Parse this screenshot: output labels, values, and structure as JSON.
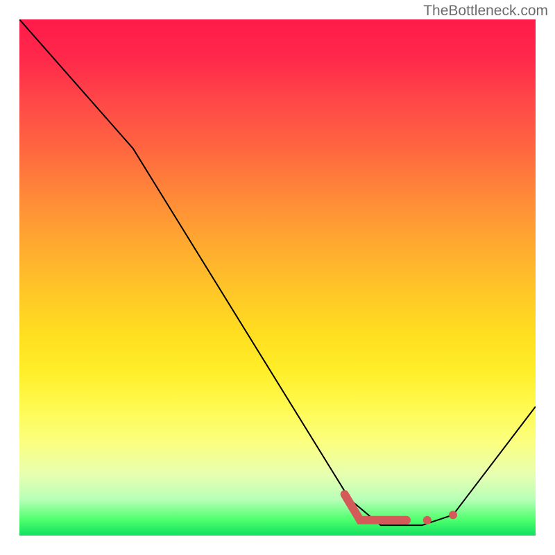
{
  "watermark": "TheBottleneck.com",
  "chart_data": {
    "type": "line",
    "title": "",
    "xlabel": "",
    "ylabel": "",
    "xlim": [
      0,
      100
    ],
    "ylim": [
      0,
      100
    ],
    "grid": false,
    "legend": false,
    "series": [
      {
        "name": "bottleneck-curve",
        "x": [
          0,
          22,
          64,
          70,
          78,
          84,
          100
        ],
        "y": [
          100,
          75,
          7,
          2,
          2,
          4,
          25
        ],
        "color": "#000000"
      }
    ],
    "highlight": {
      "name": "optimal-range",
      "type": "segment",
      "points": [
        {
          "x": 63,
          "y": 8
        },
        {
          "x": 66,
          "y": 3
        },
        {
          "x": 75,
          "y": 3
        }
      ],
      "dots": [
        {
          "x": 79,
          "y": 3
        },
        {
          "x": 84,
          "y": 4
        }
      ],
      "color": "#d45a5a"
    },
    "background": {
      "type": "vertical-gradient",
      "stops": [
        {
          "pos": 0.0,
          "color": "#ff1a4a"
        },
        {
          "pos": 0.5,
          "color": "#ffd020"
        },
        {
          "pos": 0.85,
          "color": "#fbff80"
        },
        {
          "pos": 1.0,
          "color": "#10e060"
        }
      ]
    }
  }
}
